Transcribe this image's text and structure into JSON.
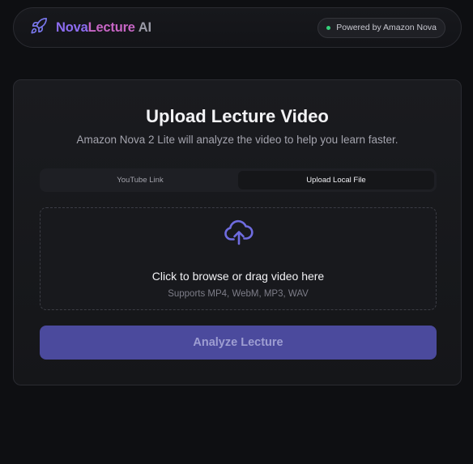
{
  "brand": {
    "name_part1": "Nova",
    "name_part2": "Lecture",
    "name_part3": "AI",
    "icon": "rocket-icon"
  },
  "badge": {
    "label": "Powered by Amazon Nova",
    "status_color": "#34d27a"
  },
  "card": {
    "title": "Upload Lecture Video",
    "subtitle": "Amazon Nova 2 Lite will analyze the video to help you learn faster."
  },
  "tabs": [
    {
      "label": "YouTube Link",
      "active": false
    },
    {
      "label": "Upload Local File",
      "active": true
    }
  ],
  "dropzone": {
    "icon": "cloud-upload-icon",
    "title": "Click to browse or drag video here",
    "hint": "Supports MP4, WebM, MP3, WAV"
  },
  "analyze_button": {
    "label": "Analyze Lecture",
    "color": "#4b4a9d"
  },
  "colors": {
    "accent": "#6f6ce0",
    "background": "#0e0f12"
  }
}
